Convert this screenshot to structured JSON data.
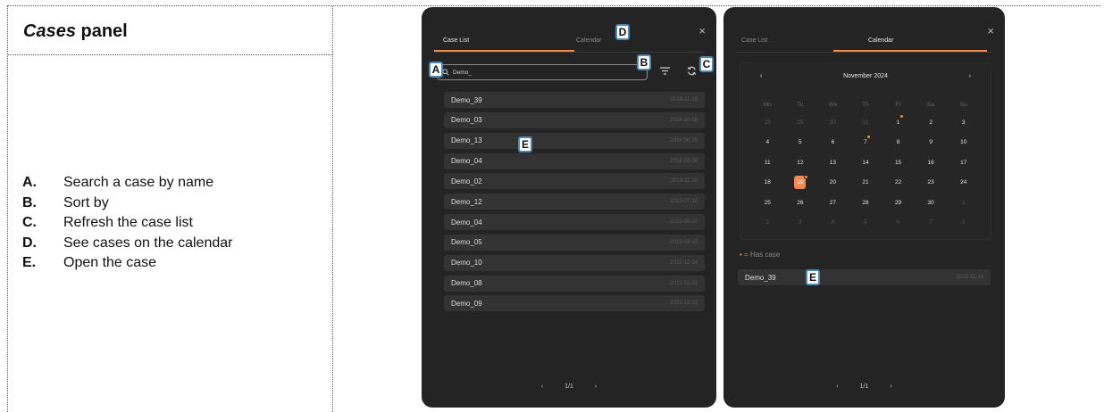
{
  "doc": {
    "title_italic": "Cases",
    "title_rest": " panel",
    "legend": [
      {
        "letter": "A.",
        "text": "Search a case by name"
      },
      {
        "letter": "B.",
        "text": "Sort by"
      },
      {
        "letter": "C.",
        "text": "Refresh the case list"
      },
      {
        "letter": "D.",
        "text": "See cases on the calendar"
      },
      {
        "letter": "E.",
        "text": "Open the case"
      }
    ]
  },
  "panel_list": {
    "tab_list": "Case List",
    "tab_calendar": "Calendar",
    "close": "×",
    "search_value": "Demo_",
    "cases": [
      {
        "name": "Demo_39",
        "date": "2024-11-19"
      },
      {
        "name": "Demo_03",
        "date": "2024-10-18"
      },
      {
        "name": "Demo_13",
        "date": "2024-08-28"
      },
      {
        "name": "Demo_04",
        "date": "2024-08-08"
      },
      {
        "name": "Demo_02",
        "date": "2023-11-16"
      },
      {
        "name": "Demo_12",
        "date": "2023-07-10"
      },
      {
        "name": "Demo_04",
        "date": "2023-06-27"
      },
      {
        "name": "Demo_05",
        "date": "2023-03-15"
      },
      {
        "name": "Demo_10",
        "date": "2022-12-14"
      },
      {
        "name": "Demo_08",
        "date": "2022-12-22"
      },
      {
        "name": "Demo_09",
        "date": "2022-12-13"
      }
    ],
    "pager": {
      "prev": "‹",
      "page": "1/1",
      "next": "›"
    }
  },
  "panel_calendar": {
    "tab_list": "Case List",
    "tab_calendar": "Calendar",
    "close": "×",
    "month_label": "November 2024",
    "prev": "‹",
    "next": "›",
    "weekdays": [
      "Mo",
      "Tu",
      "We",
      "Th",
      "Fr",
      "Sa",
      "Su"
    ],
    "has_case_legend": "= Has case",
    "bullet": "•",
    "selected_case": {
      "name": "Demo_39",
      "date": "2024-11-19"
    },
    "pager": {
      "prev": "‹",
      "page": "1/1",
      "next": "›"
    }
  },
  "badges": {
    "A": "A",
    "B": "B",
    "C": "C",
    "D": "D",
    "E": "E"
  },
  "colors": {
    "accent": "#f58a43",
    "panel_bg": "#242424",
    "badge_border": "#4a8ab5"
  }
}
